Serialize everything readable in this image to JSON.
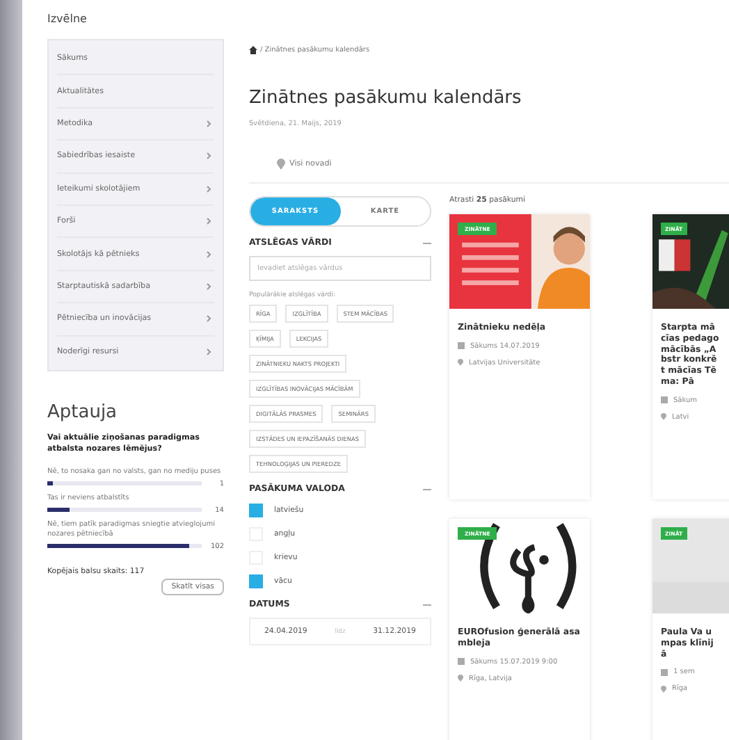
{
  "menu": {
    "title": "Izvēlne",
    "items": [
      {
        "label": "Sākums",
        "has_children": false
      },
      {
        "label": "Aktualitātes",
        "has_children": false
      },
      {
        "label": "Metodika",
        "has_children": true
      },
      {
        "label": "Sabiedrības iesaiste",
        "has_children": true
      },
      {
        "label": "Ieteikumi skolotājiem",
        "has_children": true
      },
      {
        "label": "Forši",
        "has_children": true
      },
      {
        "label": "Skolotājs kā pētnieks",
        "has_children": true
      },
      {
        "label": "Starptautiskā sadarbība",
        "has_children": true
      },
      {
        "label": "Pētniecība un inovācijas",
        "has_children": true
      },
      {
        "label": "Noderīgi resursi",
        "has_children": true
      }
    ]
  },
  "poll": {
    "title": "Aptauja",
    "question": "Vai aktuālie ziņošanas paradigmas atbalsta nozares lēmējus?",
    "options": [
      {
        "text": "Nē, to nosaka gan no valsts, gan no mediju puses",
        "level": 0.04,
        "count": "1"
      },
      {
        "text": "Tas ir neviens atbalstīts",
        "level": 0.14,
        "count": "14"
      },
      {
        "text": "Nē, tiem patīk paradigmas sniegtie atvieglojumi nozares pētniecībā",
        "level": 0.92,
        "count": "102"
      }
    ],
    "total": "Kopējais balsu skaits: 117",
    "button": "Skatīt visas"
  },
  "breadcrumb": "/ Zinātnes pasākumu kalendārs",
  "page": {
    "title": "Zinātnes pasākumu kalendārs",
    "date": "Svētdiena, 21. Maijs, 2019",
    "location": "Visi novadi"
  },
  "view_toggle": [
    {
      "label": "SARAKSTS",
      "selected": true
    },
    {
      "label": "KARTE",
      "selected": false
    }
  ],
  "keywords": {
    "title": "ATSLĒGAS VĀRDI",
    "placeholder": "Ievadiet atslēgas vārdus",
    "popular_label": "Populārākie atslēgas vārdi:",
    "tags": [
      "RĪGA",
      "IZGLĪTĪBA",
      "STEM MĀCĪBAS",
      "ĶĪMIJA",
      "LEKCIJAS",
      "ZINĀTNIEKU NAKTS PROJEKTI",
      "IZGLĪTĪBAS INOVĀCIJAS MĀCĪBĀM",
      "DIGITĀLĀS PRASMES",
      "SEMINĀRS",
      "IZSTĀDES UN IEPAZĪŠANĀS DIENAS",
      "TEHNOLOĢIJAS UN PIEREDZE"
    ]
  },
  "language": {
    "title": "PASĀKUMA VALODA",
    "options": [
      {
        "label": "latviešu",
        "checked": true
      },
      {
        "label": "angļu",
        "checked": false
      },
      {
        "label": "krievu",
        "checked": false
      },
      {
        "label": "vācu",
        "checked": true
      }
    ]
  },
  "dates": {
    "title": "DATUMS",
    "from": "24.04.2019",
    "separator": "līdz",
    "to": "31.12.2019"
  },
  "results": {
    "summary": "Atrasti **25** pasākumi",
    "cards": [
      {
        "badge": "ZINĀTNE",
        "title": "Zinātnieku nedēļa",
        "date": "Sākums 14.07.2019",
        "place": "Latvijas Universitāte"
      },
      {
        "kind": "photo-dark",
        "badge": "ZINĀT",
        "title": "Starpta mācīas pedago mācībās „Abstr konkrēt mācīas Tēma: Pā",
        "date": "Sākum",
        "place": "Latvi"
      },
      {
        "kind": "logo",
        "badge": "ZINĀTNE",
        "title": "EUROfusion ģenerālā asambleja",
        "date": "Sākums 15.07.2019 9:00",
        "place": "Rīga, Latvija"
      },
      {
        "kind": "blank",
        "badge": "ZINĀT",
        "title": "Paula Va umpas klīnijā",
        "date": "1 sem",
        "place": "Rīga"
      }
    ]
  }
}
